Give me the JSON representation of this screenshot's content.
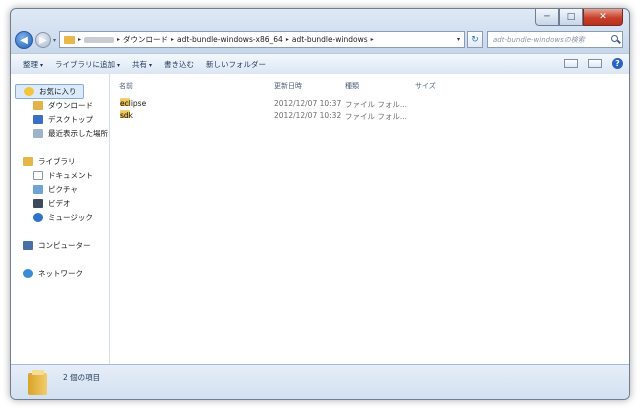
{
  "window": {
    "caption_buttons": {
      "minimize": "─",
      "maximize": "□",
      "close": "✕"
    }
  },
  "nav": {
    "back_icon": "◀",
    "forward_icon": "▶",
    "dropdown_icon": "▾"
  },
  "address": {
    "separator": "▸",
    "segments": [
      "ダウンロード",
      "adt-bundle-windows-x86_64",
      "adt-bundle-windows"
    ],
    "dropdown": "▾"
  },
  "refresh_icon": "↻",
  "search": {
    "placeholder": "adt-bundle-windowsの検索"
  },
  "toolbar": {
    "organize": "整理",
    "include_library": "ライブラリに追加",
    "share": "共有",
    "burn": "書き込む",
    "new_folder": "新しいフォルダー",
    "arrow": "▾",
    "help": "?"
  },
  "sidebar": {
    "favorites": "お気に入り",
    "downloads": "ダウンロード",
    "desktop": "デスクトップ",
    "recent": "最近表示した場所",
    "libraries": "ライブラリ",
    "documents": "ドキュメント",
    "pictures": "ピクチャ",
    "videos": "ビデオ",
    "music": "ミュージック",
    "computer": "コンピューター",
    "network": "ネットワーク"
  },
  "columns": {
    "name": "名前",
    "date": "更新日時",
    "type": "種類",
    "size": "サイズ"
  },
  "files": [
    {
      "name": "eclipse",
      "date": "2012/12/07 10:37",
      "type": "ファイル フォル..."
    },
    {
      "name": "sdk",
      "date": "2012/12/07 10:32",
      "type": "ファイル フォル..."
    }
  ],
  "status": {
    "item_count": "2 個の項目"
  }
}
